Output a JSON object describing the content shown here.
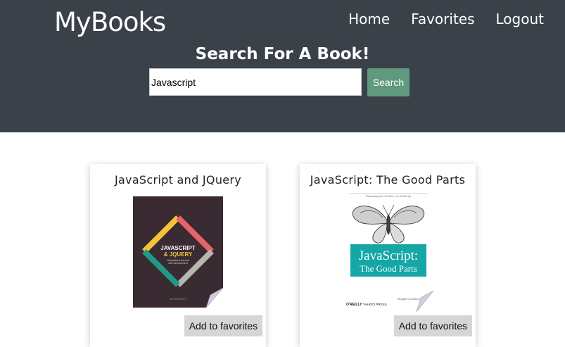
{
  "header": {
    "logo": "MyBooks",
    "nav": [
      "Home",
      "Favorites",
      "Logout"
    ]
  },
  "search": {
    "title": "Search For A Book!",
    "value": "Javascript",
    "button_label": "Search"
  },
  "books": [
    {
      "title": "JavaScript and JQuery",
      "cover_line1": "JAVASCRIPT",
      "cover_line2": "& JQUERY",
      "cover_sub1": "interactive front-end",
      "cover_sub2": "web development",
      "cover_author": "JON DUCKETT",
      "fav_label": "Add to favorites"
    },
    {
      "title": "JavaScript: The Good Parts",
      "cover_tagline": "Unearthing the excellence in JavaScript",
      "cover_line1": "JavaScript:",
      "cover_line2": "The Good Parts",
      "cover_publisher1": "O'REILLY",
      "cover_publisher2": "YAHOO! PRESS",
      "cover_author": "Douglas Crockford",
      "fav_label": "Add to favorites"
    }
  ],
  "colors": {
    "header_bg": "#3a4149",
    "search_button": "#5f9a7e",
    "fav_button": "#d6d6d6"
  }
}
